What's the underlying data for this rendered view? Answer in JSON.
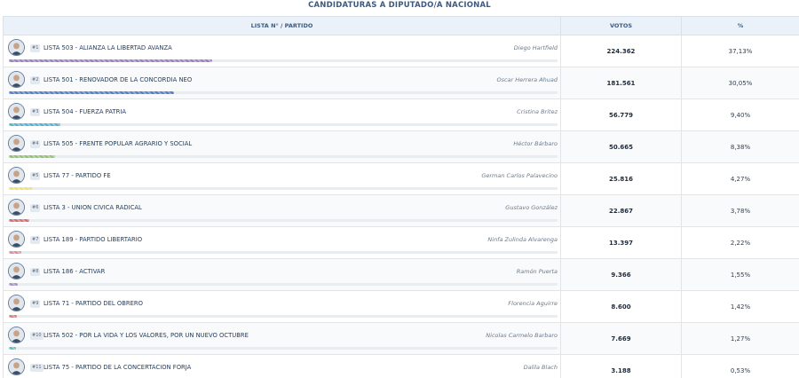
{
  "title": "CANDIDATURAS A DIPUTADO/A NACIONAL",
  "columns": {
    "list": "LISTA N° / PARTIDO",
    "votes": "VOTOS",
    "pct": "%"
  },
  "rows": [
    {
      "rank": "#1",
      "party": "LISTA 503 - ALIANZA LA LIBERTAD AVANZA",
      "candidate": "Diego Hartfield",
      "votes": "224.362",
      "pct": "37,13%",
      "share": 37.13,
      "color": "#9b7fc2"
    },
    {
      "rank": "#2",
      "party": "LISTA 501 - RENOVADOR DE LA CONCORDIA NEO",
      "candidate": "Oscar Herrera Ahuad",
      "votes": "181.561",
      "pct": "30,05%",
      "share": 30.05,
      "color": "#4f7fd0"
    },
    {
      "rank": "#3",
      "party": "LISTA 504 - FUERZA PATRIA",
      "candidate": "Cristina Britez",
      "votes": "56.779",
      "pct": "9,40%",
      "share": 9.4,
      "color": "#4fb3d9"
    },
    {
      "rank": "#4",
      "party": "LISTA 505 - FRENTE POPULAR AGRARIO Y SOCIAL",
      "candidate": "Héctor Bárbaro",
      "votes": "50.665",
      "pct": "8,38%",
      "share": 8.38,
      "color": "#8cc46b"
    },
    {
      "rank": "#5",
      "party": "LISTA 77 - PARTIDO FE",
      "candidate": "German Carlos Palavecino",
      "votes": "25.816",
      "pct": "4,27%",
      "share": 4.27,
      "color": "#f2df6b"
    },
    {
      "rank": "#6",
      "party": "LISTA 3 - UNION CIVICA RADICAL",
      "candidate": "Gustavo González",
      "votes": "22.867",
      "pct": "3,78%",
      "share": 3.78,
      "color": "#d96b6b"
    },
    {
      "rank": "#7",
      "party": "LISTA 189 - PARTIDO LIBERTARIO",
      "candidate": "Ninfa Zulinda Alvarenga",
      "votes": "13.397",
      "pct": "2,22%",
      "share": 2.22,
      "color": "#e58aa6"
    },
    {
      "rank": "#8",
      "party": "LISTA 186 - ACTIVAR",
      "candidate": "Ramón Puerta",
      "votes": "9.366",
      "pct": "1,55%",
      "share": 1.55,
      "color": "#a98fd6"
    },
    {
      "rank": "#9",
      "party": "LISTA 71 - PARTIDO DEL OBRERO",
      "candidate": "Florencia Aguirre",
      "votes": "8.600",
      "pct": "1,42%",
      "share": 1.42,
      "color": "#e57a7a"
    },
    {
      "rank": "#10",
      "party": "LISTA 502 - POR LA VIDA Y LOS VALORES, POR UN NUEVO OCTUBRE",
      "candidate": "Nicolas Carmelo Barbaro",
      "votes": "7.669",
      "pct": "1,27%",
      "share": 1.27,
      "color": "#5bc0c9"
    },
    {
      "rank": "#11",
      "party": "LISTA 75 - PARTIDO DE LA CONCERTACION FORJA",
      "candidate": "Dalila Blach",
      "votes": "3.188",
      "pct": "0,53%",
      "share": 0.53,
      "color": "#e8b36b"
    }
  ]
}
